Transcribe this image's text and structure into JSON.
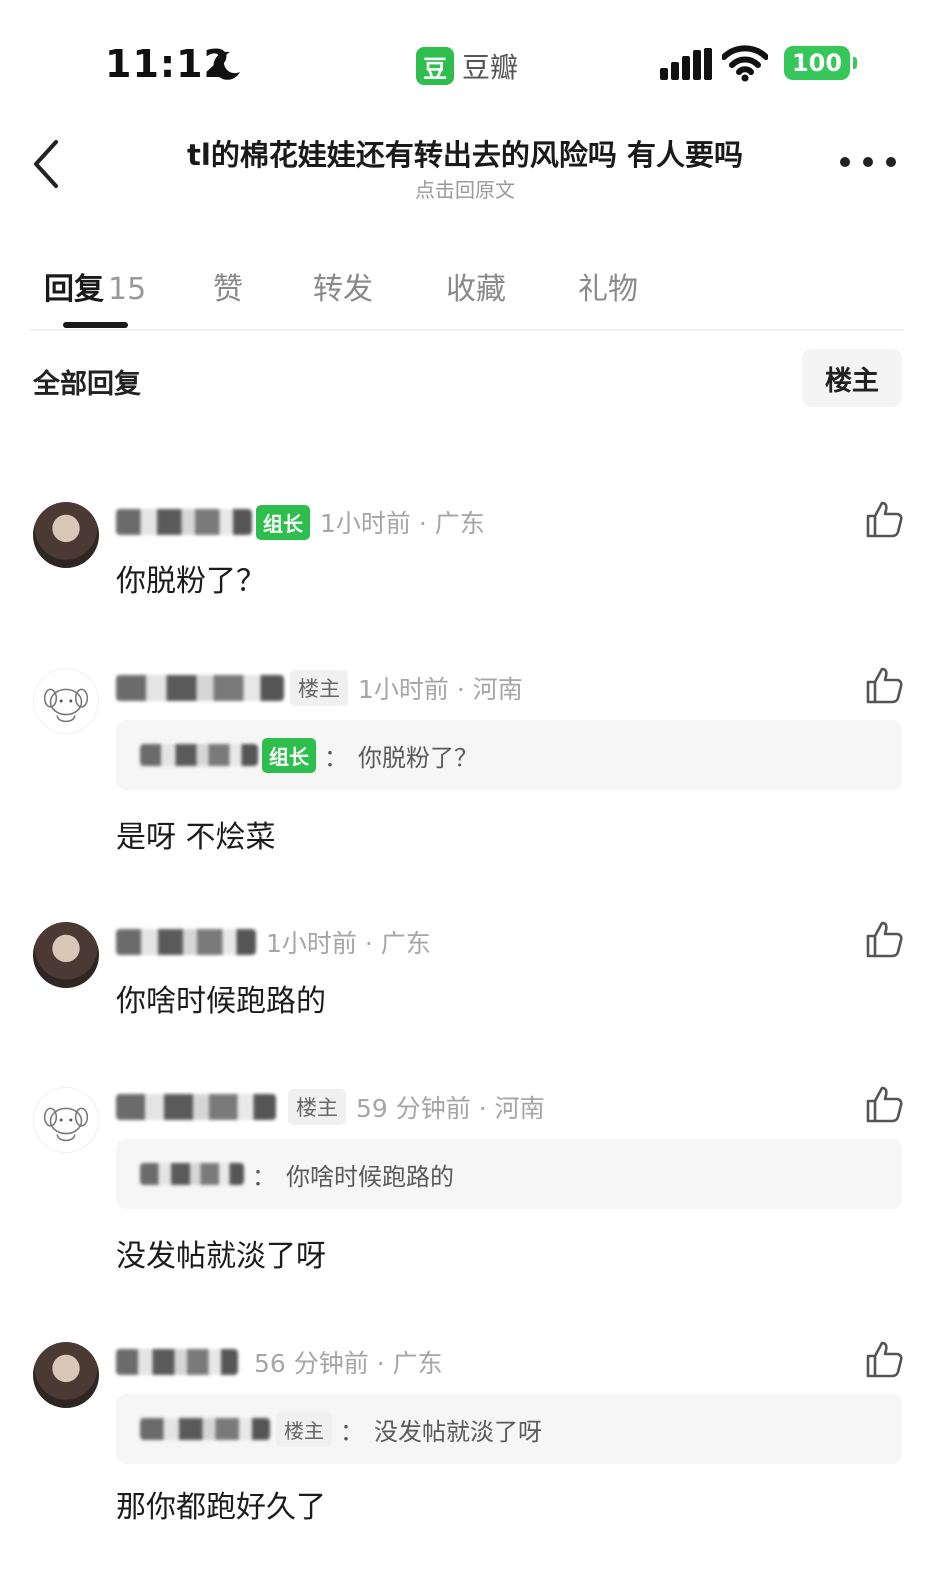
{
  "status_bar": {
    "time": "11:12",
    "app_logo": "豆",
    "app_name": "豆瓣",
    "battery": "100",
    "icons": [
      "moon-icon",
      "signal-icon",
      "wifi-icon",
      "battery-icon"
    ]
  },
  "nav": {
    "title": "tl的棉花娃娃还有转出去的风险吗 有人要吗",
    "subtitle": "点击回原文",
    "icons": [
      "back-chevron-icon",
      "more-icon"
    ]
  },
  "tabs": [
    {
      "label": "回复",
      "count": "15",
      "active": true
    },
    {
      "label": "赞"
    },
    {
      "label": "转发"
    },
    {
      "label": "收藏"
    },
    {
      "label": "礼物"
    }
  ],
  "list_header": {
    "label": "全部回复",
    "filter_button": "楼主"
  },
  "colors": {
    "accent_green": "#2dbe4e",
    "battery_green": "#35c759",
    "meta_gray": "#a6a6a6",
    "quote_bg": "#f6f6f6"
  },
  "comments": [
    {
      "badge": "组长",
      "meta": "1小时前 · 广东",
      "text": "你脱粉了？"
    },
    {
      "badge": "楼主",
      "meta": "1小时前 · 河南",
      "quote": {
        "badge": "组长",
        "colon": "：",
        "text": "你脱粉了？"
      },
      "text": "是呀  不烩菜"
    },
    {
      "meta": "1小时前 · 广东",
      "text": "你啥时候跑路的"
    },
    {
      "badge": "楼主",
      "meta": "59 分钟前 · 河南",
      "quote": {
        "colon": "：",
        "text": "你啥时候跑路的"
      },
      "text": "没发帖就淡了呀"
    },
    {
      "meta": "56 分钟前 · 广东",
      "quote": {
        "badge": "楼主",
        "colon": "：",
        "text": "没发帖就淡了呀"
      },
      "text": "那你都跑好久了"
    }
  ]
}
